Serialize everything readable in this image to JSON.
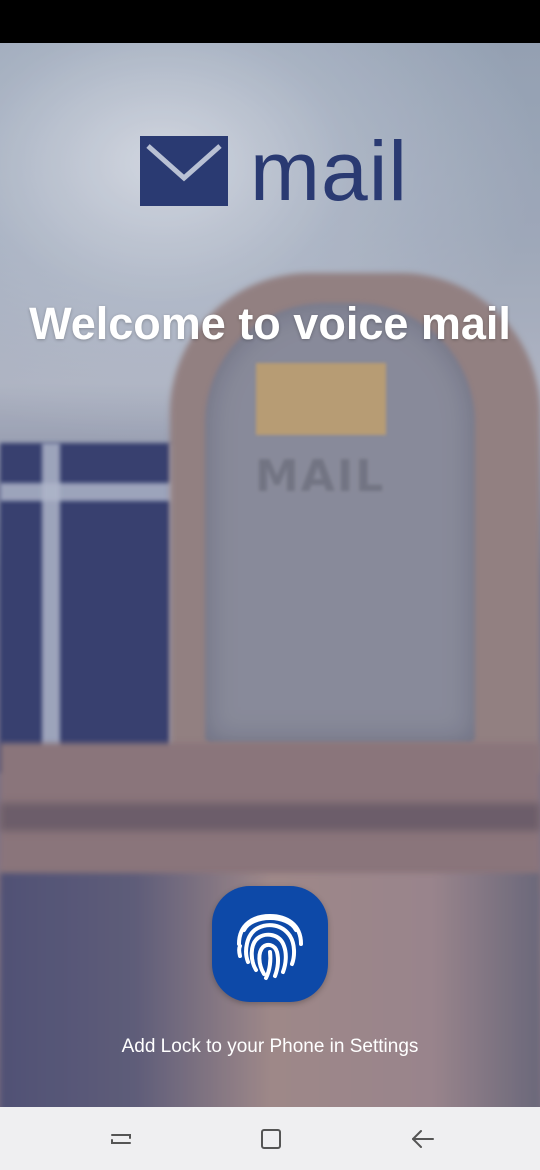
{
  "app": {
    "logo_text": "mail",
    "logo_color": "#2a3a72",
    "logo_icon": "envelope-icon"
  },
  "welcome": {
    "title": "Welcome to voice mail"
  },
  "background": {
    "mailbox_text": "MAIL"
  },
  "fingerprint": {
    "icon": "fingerprint-icon",
    "color": "#0d49a8",
    "hint": "Add Lock to your Phone in Settings"
  },
  "nav_bar": {
    "buttons": [
      {
        "icon": "recent-apps-icon"
      },
      {
        "icon": "home-icon"
      },
      {
        "icon": "back-icon"
      }
    ]
  }
}
